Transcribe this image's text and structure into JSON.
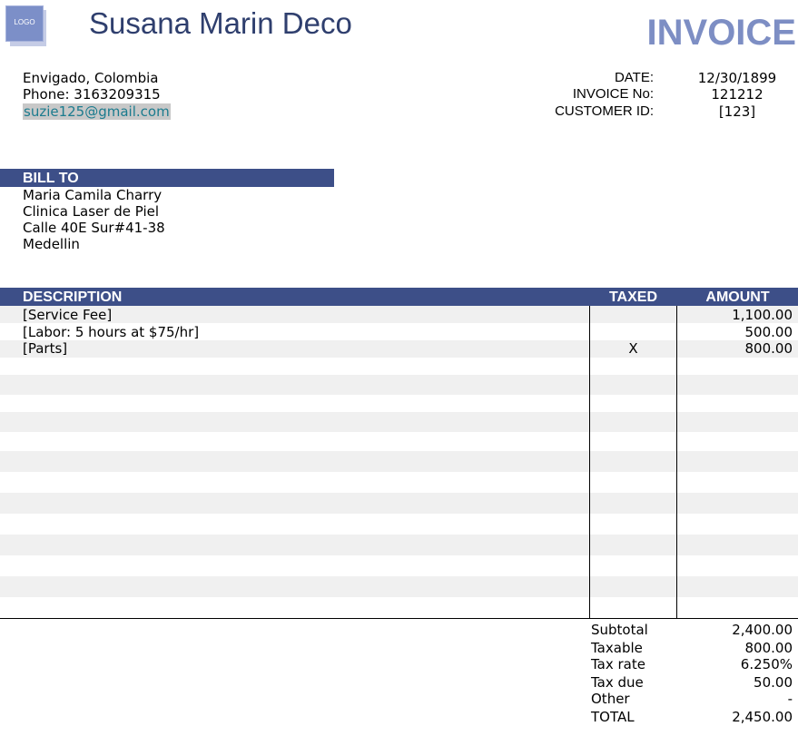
{
  "header": {
    "logo_text": "LOGO",
    "company_name": "Susana Marin Deco",
    "doc_title": "INVOICE"
  },
  "sender": {
    "city": "Envigado, Colombia",
    "phone": "Phone: 3163209315",
    "email": "suzie125@gmail.com"
  },
  "meta": [
    {
      "label": "DATE:",
      "value": "12/30/1899"
    },
    {
      "label": "INVOICE No:",
      "value": "121212"
    },
    {
      "label": "CUSTOMER ID:",
      "value": "[123]"
    }
  ],
  "bill_to": {
    "heading": "BILL TO",
    "lines": [
      "Maria Camila Charry",
      "Clinica Laser de Piel",
      "Calle 40E Sur#41-38",
      "Medellin"
    ]
  },
  "table": {
    "headers": {
      "description": "DESCRIPTION",
      "taxed": "TAXED",
      "amount": "AMOUNT"
    },
    "rows": [
      {
        "description": "[Service Fee]",
        "taxed": "",
        "amount": "1,100.00"
      },
      {
        "description": "[Labor: 5 hours at $75/hr]",
        "taxed": "",
        "amount": "500.00"
      },
      {
        "description": "[Parts]",
        "taxed": "X",
        "amount": "800.00"
      }
    ]
  },
  "totals": [
    {
      "label": "Subtotal",
      "value": "2,400.00"
    },
    {
      "label": "Taxable",
      "value": "800.00"
    },
    {
      "label": "Tax rate",
      "value": "6.250%"
    },
    {
      "label": "Tax due",
      "value": "50.00"
    },
    {
      "label": "Other",
      "value": "-"
    },
    {
      "label": "TOTAL",
      "value": "2,450.00"
    }
  ],
  "colors": {
    "header_bar": "#3d4f88",
    "title": "#7d8ec4",
    "company": "#2f3f6e",
    "stripe": "#f0f0f0"
  }
}
